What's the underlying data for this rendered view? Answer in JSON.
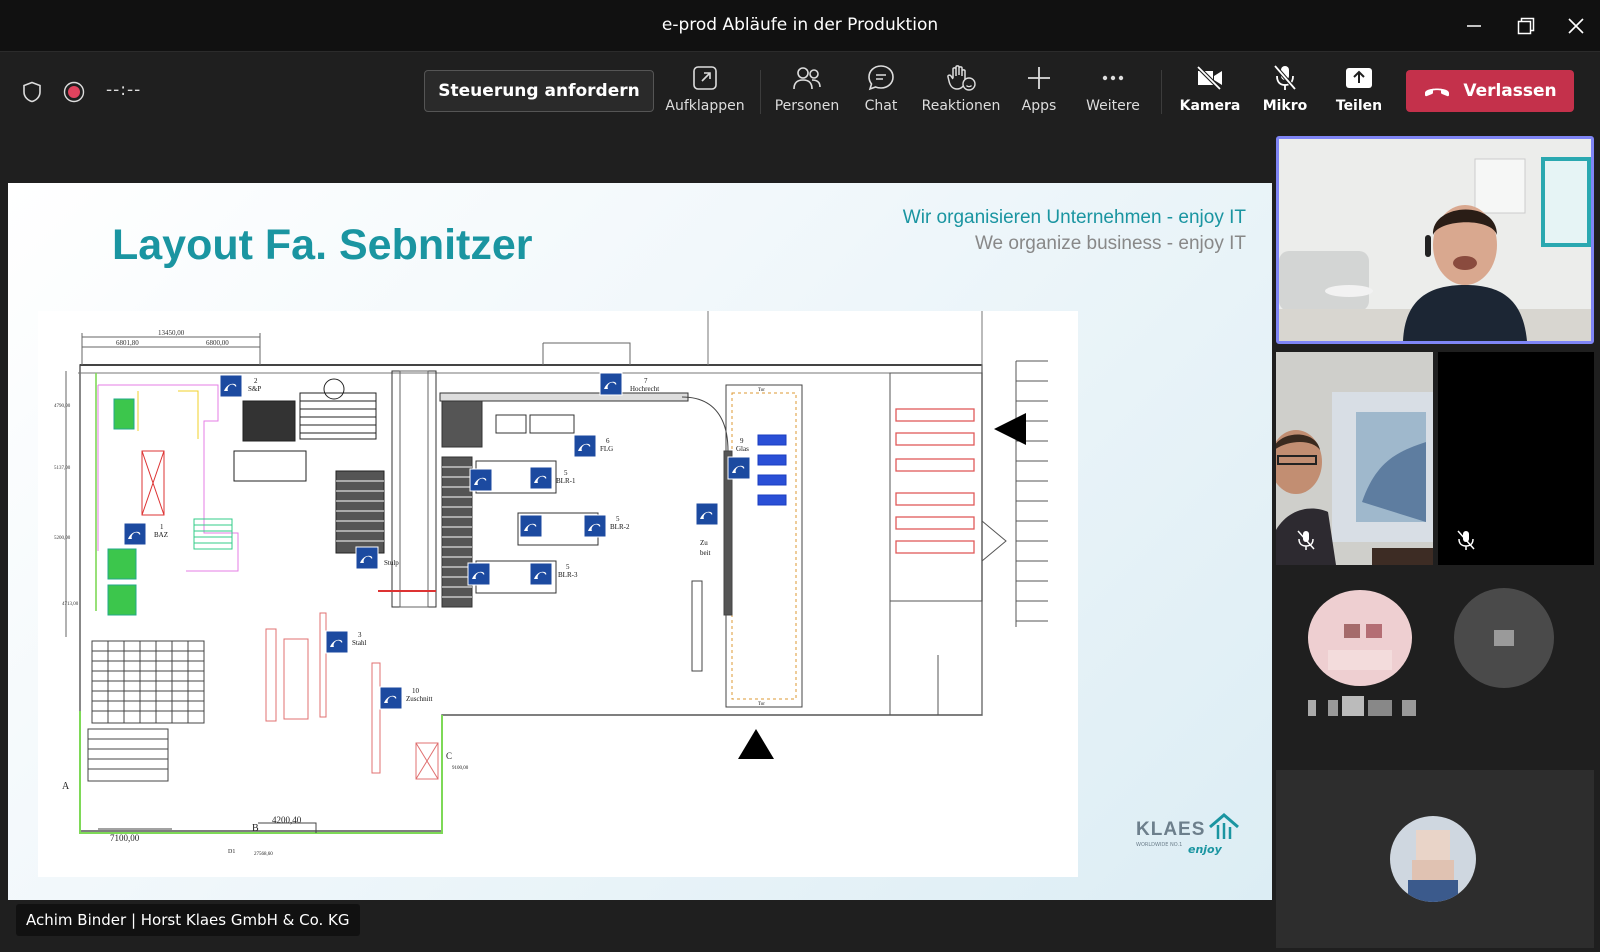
{
  "window": {
    "title": "e-prod Abläufe in der Produktion"
  },
  "toolbar": {
    "timer": "--:--",
    "request_control": "Steuerung anfordern",
    "tools": [
      {
        "label": "Aufklappen",
        "icon": "pop-out-icon"
      },
      {
        "label": "Personen",
        "icon": "people-icon"
      },
      {
        "label": "Chat",
        "icon": "chat-icon"
      },
      {
        "label": "Reaktionen",
        "icon": "raise-hand-icon"
      },
      {
        "label": "Apps",
        "icon": "plus-icon"
      },
      {
        "label": "Weitere",
        "icon": "more-icon"
      },
      {
        "label": "Kamera",
        "icon": "camera-off-icon"
      },
      {
        "label": "Mikro",
        "icon": "mic-off-icon"
      },
      {
        "label": "Teilen",
        "icon": "share-icon"
      }
    ],
    "leave": "Verlassen",
    "leave_color": "#c4314b"
  },
  "slide": {
    "title": "Layout Fa. Sebnitzer",
    "tagline_de": "Wir organisieren Unternehmen - enjoy IT",
    "tagline_en": "We organize business - enjoy IT",
    "accent_color": "#1a95a1",
    "logo_name": "KLAES",
    "logo_sub": "WORLDWIDE NO.1",
    "logo_enjoy": "enjoy",
    "plan_labels": {
      "dim_top": "13450,00",
      "dim_a": "6801,80",
      "dim_b": "6800,00",
      "dim_bottom": "7100,00",
      "dim_b2": "4200,40",
      "dim_c": "27568,60",
      "dim_d": "9100,00",
      "left_1": "4790,00",
      "left_2": "5137,00",
      "left_3": "5200,00",
      "left_4": "4713,00",
      "letter_a": "A",
      "letter_b": "B",
      "letter_c": "C",
      "letter_d": "D1",
      "st_sp_n": "2",
      "st_sp": "S&P",
      "st_baz_n": "1",
      "st_baz": "BAZ",
      "st_stahl_n": "3",
      "st_stahl": "Stahl",
      "st_zuschnitt_n": "10",
      "st_zuschnitt": "Zuschnitt",
      "st_hk_n": "7",
      "st_hk": "Hochrecht",
      "st_flg_n": "6",
      "st_flg": "FLG",
      "st_blr1_n": "5",
      "st_blr1": "BLR-1",
      "st_blr2_n": "5",
      "st_blr2": "BLR-2",
      "st_blr3_n": "5",
      "st_blr3": "BLR-3",
      "st_glas_n": "9",
      "st_glas": "Glas",
      "st_stulp": "Stulp",
      "st_zu_1": "Zu",
      "st_zu_2": "beit",
      "door_1": "Tor",
      "door_2": "Tor"
    }
  },
  "presenter": {
    "label": "Achim Binder | Horst Klaes GmbH & Co. KG"
  },
  "participants": {
    "active_border": "#7f85f5"
  }
}
